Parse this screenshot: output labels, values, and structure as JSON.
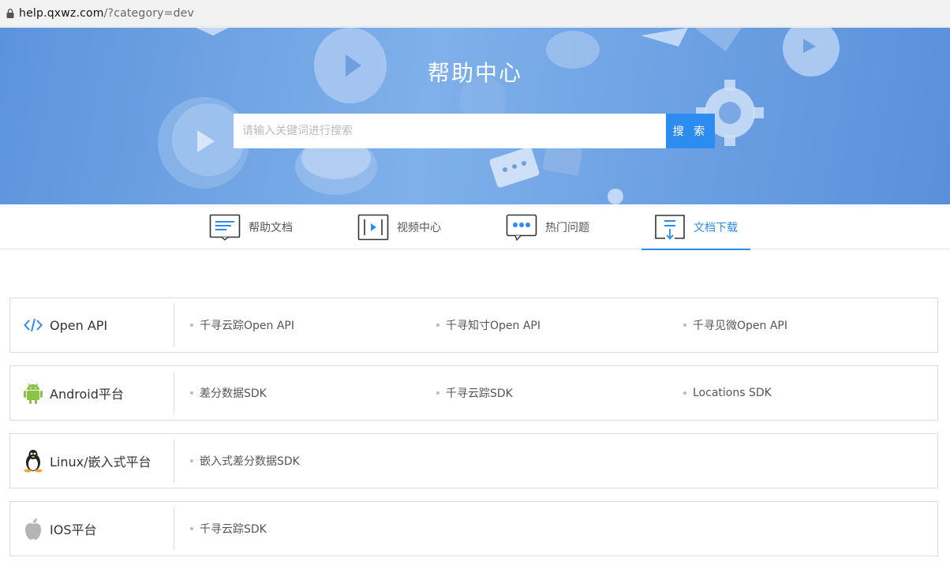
{
  "browser": {
    "url_host": "help.qxwz.com",
    "url_path": "/?category=dev"
  },
  "hero": {
    "title": "帮助中心",
    "search_placeholder": "请输入关键词进行搜索",
    "search_button": "搜 索"
  },
  "tabs": [
    {
      "label": "帮助文档",
      "icon": "document-lines-icon"
    },
    {
      "label": "视频中心",
      "icon": "video-play-icon"
    },
    {
      "label": "热门问题",
      "icon": "chat-bubble-icon"
    },
    {
      "label": "文档下载",
      "icon": "download-icon",
      "active": true
    }
  ],
  "accent_color": "#2d8cf0",
  "categories": [
    {
      "name": "Open API",
      "icon": "code-icon",
      "links": [
        "千寻云踪Open API",
        "千寻知寸Open API",
        "千寻见微Open API"
      ]
    },
    {
      "name": "Android平台",
      "icon": "android-icon",
      "links": [
        "差分数据SDK",
        "千寻云踪SDK",
        "Locations SDK"
      ]
    },
    {
      "name": "Linux/嵌入式平台",
      "icon": "linux-penguin-icon",
      "links": [
        "嵌入式差分数据SDK"
      ]
    },
    {
      "name": "IOS平台",
      "icon": "apple-icon",
      "links": [
        "千寻云踪SDK"
      ]
    }
  ]
}
